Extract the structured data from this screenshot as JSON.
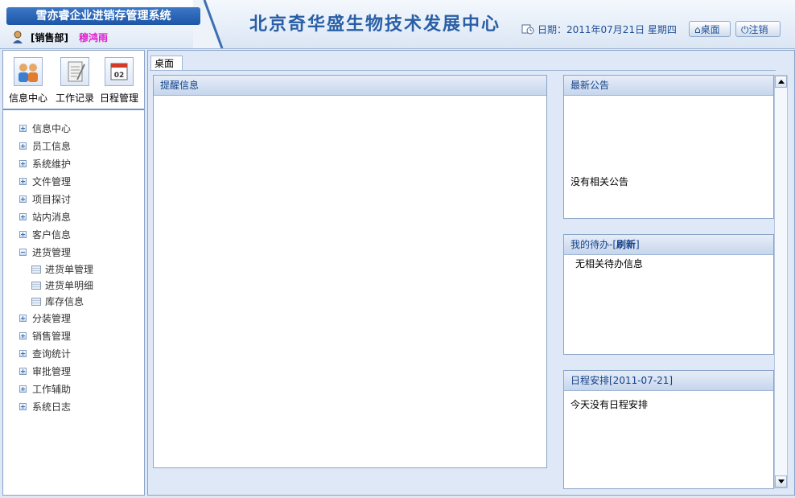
{
  "header": {
    "system_title": "雪亦睿企业进销存管理系统",
    "department": "[销售部]",
    "user_name": "穆鸿雨",
    "org_title": "北京奇华盛生物技术发展中心",
    "date_text": "日期：2011年07月21日 星期四",
    "desktop_button": "桌面",
    "logout_button": "注销"
  },
  "shortcuts": [
    {
      "label": "信息中心",
      "icon": "people-icon"
    },
    {
      "label": "工作记录",
      "icon": "notepad-icon"
    },
    {
      "label": "日程管理",
      "icon": "calendar-icon",
      "badge": "02"
    }
  ],
  "nav": {
    "items": [
      "信息中心",
      "员工信息",
      "系统维护",
      "文件管理",
      "项目探讨",
      "站内消息",
      "客户信息",
      "进货管理"
    ],
    "sub_items": [
      "进货单管理",
      "进货单明细",
      "库存信息"
    ],
    "items_after": [
      "分装管理",
      "销售管理",
      "查询统计",
      "审批管理",
      "工作辅助",
      "系统日志"
    ]
  },
  "tab": {
    "label": "桌面"
  },
  "panels": {
    "remind": {
      "title": "提醒信息"
    },
    "notice": {
      "title": "最新公告",
      "body": "没有相关公告"
    },
    "todo": {
      "title_prefix": "我的待办-[",
      "title_link": "刷新",
      "title_suffix": "]",
      "body": "无相关待办信息"
    },
    "schedule": {
      "title": "日程安排[2011-07-21]",
      "body": "今天没有日程安排"
    }
  },
  "colors": {
    "accent": "#15428b",
    "user_name": "#e11fd0",
    "title_bar": "#1c56a8"
  }
}
